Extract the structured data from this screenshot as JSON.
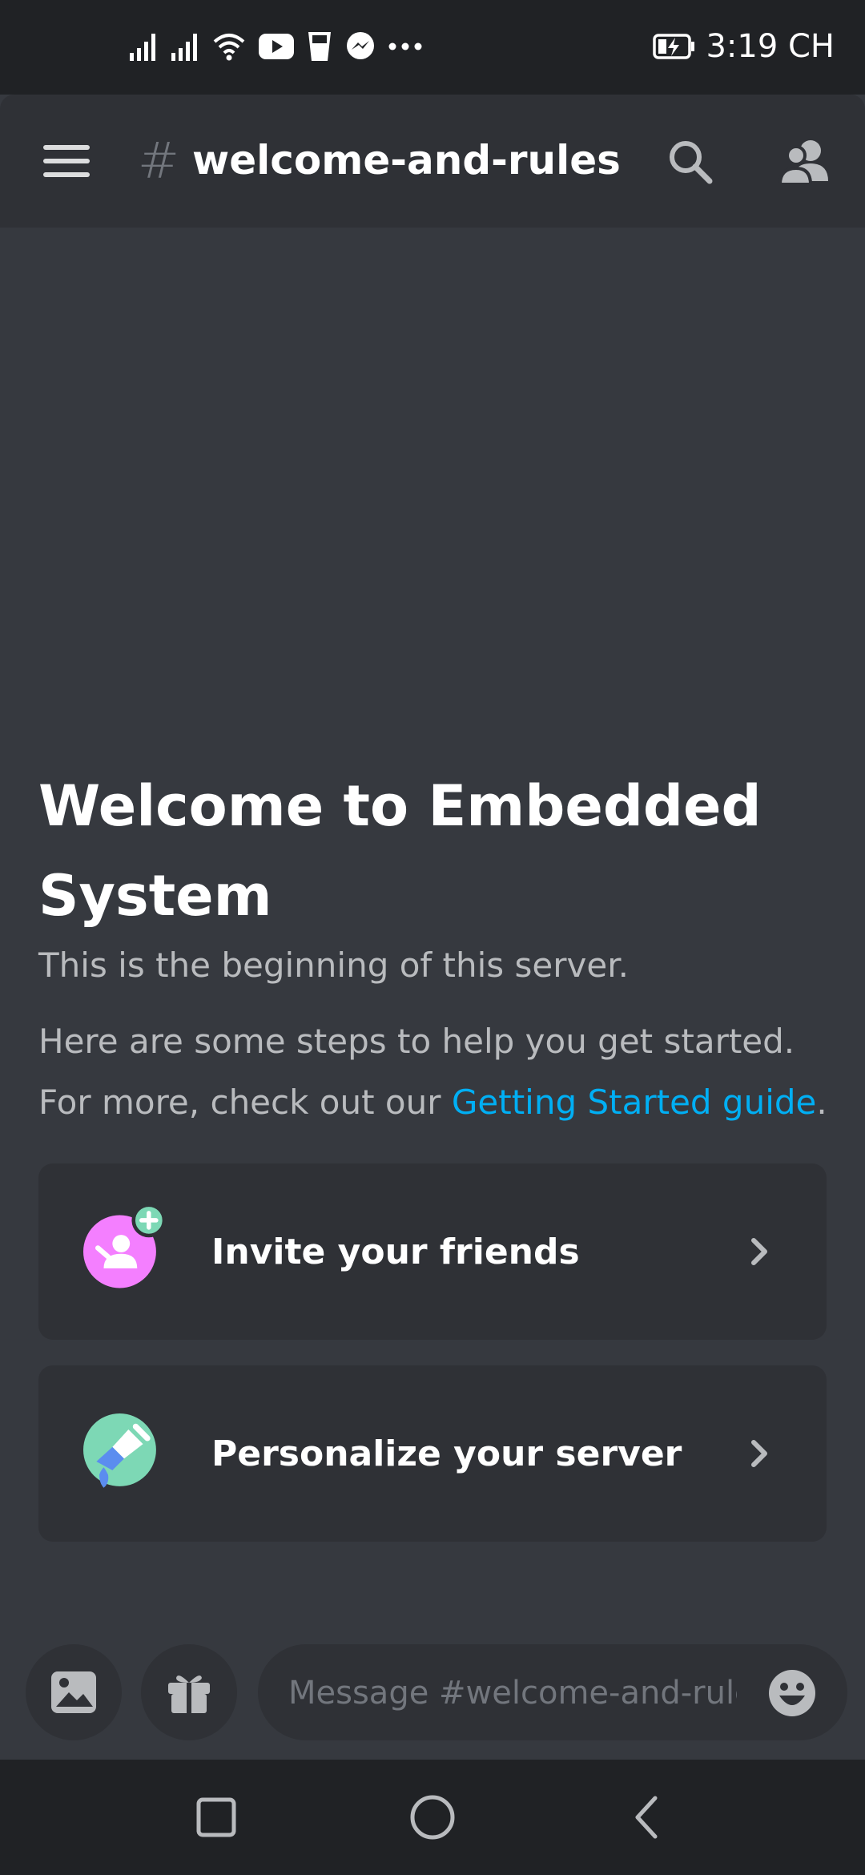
{
  "status_bar": {
    "time": "3:19 CH",
    "icons": [
      "signal-icon",
      "signal-icon",
      "wifi-icon",
      "youtube-icon",
      "cup-icon",
      "messenger-icon",
      "more-icon",
      "battery-charging-icon"
    ]
  },
  "header": {
    "hash": "#",
    "channel_name": "welcome-and-rules",
    "icons": [
      "menu-icon",
      "search-icon",
      "members-icon"
    ]
  },
  "welcome": {
    "title": "Welcome to Embedded System",
    "subtitle": "This is the beginning of this server.",
    "help_text": "Here are some steps to help you get started. For more, check out our ",
    "link_text": "Getting Started guide",
    "help_end": "."
  },
  "cards": [
    {
      "label": "Invite your friends",
      "icon": "invite-friends-icon",
      "color": "#f47fff"
    },
    {
      "label": "Personalize your server",
      "icon": "paint-brush-icon",
      "color": "#7dd8b5"
    }
  ],
  "composer": {
    "placeholder": "Message #welcome-and-rules",
    "icons": [
      "image-icon",
      "gift-icon",
      "emoji-icon"
    ]
  },
  "nav": {
    "icons": [
      "recents-icon",
      "home-icon",
      "back-icon"
    ]
  },
  "colors": {
    "background": "#36393f",
    "header": "#2f3136",
    "status_bar": "#202225",
    "link": "#00aff4"
  }
}
